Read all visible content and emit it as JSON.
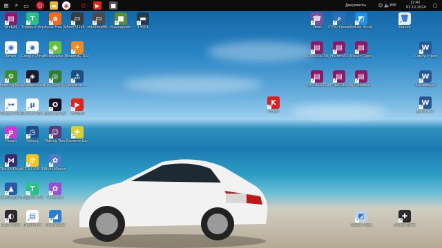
{
  "taskbar": {
    "search_label": "Документы",
    "language": "УКР",
    "time": "12:42",
    "date": "03.12.2024"
  },
  "desktop": {
    "icons_left": [
      {
        "label": "WinRAR",
        "icon": "winrar-icon",
        "color": "#8b1a6b",
        "glyph": "▤"
      },
      {
        "label": "Торрент Игруха",
        "icon": "torrent-app-icon",
        "color": "#26c281",
        "glyph": "T"
      },
      {
        "label": "Avast Free Antivirus",
        "icon": "avast-icon",
        "color": "#f26b1d",
        "glyph": "a"
      },
      {
        "label": "6cef741a5...",
        "icon": "image-file-icon",
        "color": "#3a3a3a",
        "glyph": "▭"
      },
      {
        "label": "b0e9bae86...",
        "icon": "image-file-icon",
        "color": "#4a4a4a",
        "glyph": "▭"
      },
      {
        "label": "Майнкрафт",
        "icon": "minecraft-icon",
        "color": "#5b8a3a",
        "glyph": "■"
      },
      {
        "label": "13001",
        "icon": "folder-icon",
        "color": "#233a55",
        "glyph": "▬"
      },
      {
        "label": "Arteni",
        "icon": "chrome-icon",
        "color": "#ffffff",
        "glyph": "◉"
      },
      {
        "label": "Google Chrome",
        "icon": "chrome-icon",
        "color": "#ffffff",
        "glyph": "◉"
      },
      {
        "label": "BlueStacks X",
        "icon": "bluestacks-icon",
        "color": "#68c53a",
        "glyph": "◆"
      },
      {
        "label": "BeamNG DRIVE",
        "icon": "beamng-icon",
        "color": "#f28a1d",
        "glyph": "✦"
      },
      {
        "label": "Farming Simulator 19",
        "icon": "farming-icon",
        "color": "#3d8c2b",
        "glyph": "⚙"
      },
      {
        "label": "Wondershare Filmora 13",
        "icon": "filmora-icon",
        "color": "#1a1a2e",
        "glyph": "◈"
      },
      {
        "label": "City Car Driving",
        "icon": "citycar-icon",
        "color": "#2e7d32",
        "glyph": "◎"
      },
      {
        "label": "World_of_...",
        "icon": "warships-icon",
        "color": "#1c4f82",
        "glyph": "⚓"
      },
      {
        "label": "Google Passwor...",
        "icon": "password-icon",
        "color": "#ffffff",
        "glyph": "⊶"
      },
      {
        "label": "µTorrent Web",
        "icon": "utorrent-icon",
        "color": "#ffffff",
        "glyph": "µ"
      },
      {
        "label": "Браузер Opera GX",
        "icon": "opera-gx-icon",
        "color": "#1b0f24",
        "glyph": "O"
      },
      {
        "label": "YouTube",
        "icon": "youtube-icon",
        "color": "#e62117",
        "glyph": "▶"
      },
      {
        "label": "Picsart",
        "icon": "picsart-icon",
        "color": "#c83bd8",
        "glyph": "p"
      },
      {
        "label": "Speccy",
        "icon": "speccy-icon",
        "color": "#1e4f8a",
        "glyph": "◷"
      },
      {
        "label": "Talking Tom",
        "icon": "game-icon",
        "color": "#5a3a7a",
        "glyph": "☺"
      },
      {
        "label": "Extreme Car Driving",
        "icon": "car-game-icon",
        "color": "#d7cf2b",
        "glyph": "✚"
      },
      {
        "label": "The KMPlayer",
        "icon": "kmplayer-icon",
        "color": "#3b2a6e",
        "glyph": "⋈"
      },
      {
        "label": "S.T.A.L.K.E.R. Shadow of ...",
        "icon": "stalker-icon",
        "color": "#f5c518",
        "glyph": "☢"
      },
      {
        "label": "Multi-Minecraft",
        "icon": "multimc-icon",
        "color": "#4f7ac9",
        "glyph": "✿"
      },
      {
        "label": "Landscape Craft",
        "icon": "landscape-icon",
        "color": "#2b5aa8",
        "glyph": "▲"
      },
      {
        "label": "Торрент Игруха",
        "icon": "torrent-app-icon",
        "color": "#26c281",
        "glyph": "T"
      },
      {
        "label": "Minecraft",
        "icon": "minecraft-launcher-icon",
        "color": "#9b4fd1",
        "glyph": "✿"
      },
      {
        "label": "OBS Studio",
        "icon": "obs-icon",
        "color": "#2b2b2b",
        "glyph": "◐"
      },
      {
        "label": "Document",
        "icon": "document-icon",
        "color": "#ffffff",
        "glyph": "▤"
      },
      {
        "label": "FoxInstaller",
        "icon": "fox-icon",
        "color": "#2a7fd4",
        "glyph": "◢"
      }
    ],
    "icons_right": [
      {
        "label": "Viber",
        "icon": "viber-icon",
        "color": "#7b519d",
        "glyph": "☎"
      },
      {
        "label": "STDU Viewer",
        "icon": "stdu-icon",
        "color": "#2a6db4",
        "glyph": "⌕"
      },
      {
        "label": "Roblox Studio",
        "icon": "roblox-icon",
        "color": "#1f8fe5",
        "glyph": "◩"
      },
      {
        "label": "Кошик",
        "icon": "recycle-bin-icon",
        "color": "#e6eef5",
        "glyph": "🗑"
      },
      {
        "label": "AD00Lua238",
        "icon": "rar-archive-icon",
        "color": "#8b1a6b",
        "glyph": "▤"
      },
      {
        "label": "FKRtdhW2",
        "icon": "rar-archive-icon",
        "color": "#8b1a6b",
        "glyph": "▤"
      },
      {
        "label": "Nissan Qashqai I...",
        "icon": "rar-archive-icon",
        "color": "#8b1a6b",
        "glyph": "▤"
      },
      {
        "label": "Самсунг регламент",
        "icon": "word-doc-icon",
        "color": "#2b579a",
        "glyph": "W"
      },
      {
        "label": "VW_PASSAT...",
        "icon": "rar-archive-icon",
        "color": "#8b1a6b",
        "glyph": "▤"
      },
      {
        "label": "MTHp1GEn...",
        "icon": "rar-archive-icon",
        "color": "#8b1a6b",
        "glyph": "▤"
      },
      {
        "label": "9J7Dtemvq...",
        "icon": "rar-archive-icon",
        "color": "#8b1a6b",
        "glyph": "▤"
      },
      {
        "label": "Англійська",
        "icon": "word-doc-icon",
        "color": "#2b579a",
        "glyph": "W"
      },
      {
        "label": "Kinder",
        "icon": "kinder-icon",
        "color": "#e02020",
        "glyph": "K"
      },
      {
        "label": "Документ",
        "icon": "word-doc-icon",
        "color": "#2b579a",
        "glyph": "W"
      },
      {
        "label": "Roblox Player",
        "icon": "roblox-player-icon",
        "color": "#bcd0e0",
        "glyph": "◩"
      },
      {
        "label": "Steam Game",
        "icon": "gamepad-icon",
        "color": "#2a2a2a",
        "glyph": "✚"
      }
    ]
  },
  "accent_colors": {
    "taskbar_bg": "#0c0c0c",
    "label_text": "#ffffff"
  }
}
